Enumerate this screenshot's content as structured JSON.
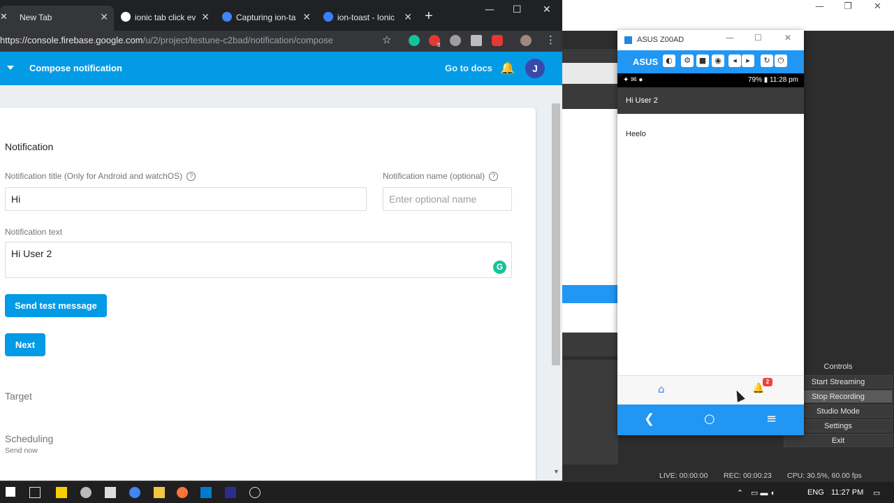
{
  "chrome": {
    "tabs": [
      {
        "label": "New Tab",
        "active": true
      },
      {
        "label": "ionic tab click ev",
        "active": false
      },
      {
        "label": "Capturing ion-ta",
        "active": false
      },
      {
        "label": "ion-toast - Ionic",
        "active": false
      }
    ],
    "url_host": "https://console.firebase.google.com",
    "url_path": "/u/2/project/testune-c2bad/notification/compose",
    "extension_badge": "8"
  },
  "firebase": {
    "page_title": "Compose notification",
    "go_to_docs": "Go to docs",
    "avatar_initial": "J",
    "section_title": "Notification",
    "title_label": "Notification title (Only for Android and watchOS)",
    "title_value": "Hi",
    "name_label": "Notification name (optional)",
    "name_placeholder": "Enter optional name",
    "text_label": "Notification text",
    "text_value": "Hi User 2",
    "send_test_button": "Send test message",
    "next_button": "Next",
    "target_section": "Target",
    "scheduling_section": "Scheduling",
    "scheduling_sub": "Send now"
  },
  "phone": {
    "window_title": "ASUS Z00AD",
    "toolbar_name": "ASUS",
    "battery": "79%",
    "time": "11:28 pm",
    "app_title": "Hi User 2",
    "body_text": "Heelo",
    "badge_count": "2"
  },
  "obs": {
    "controls_title": "Controls",
    "buttons": [
      "Start Streaming",
      "Stop Recording",
      "Studio Mode",
      "Settings",
      "Exit"
    ],
    "live": "LIVE: 00:00:00",
    "rec": "REC: 00:00:23",
    "cpu": "CPU: 30.5%, 60.00 fps"
  },
  "taskbar": {
    "lang": "ENG",
    "clock": "11:27 PM"
  },
  "colors": {
    "firebase_blue": "#039be5",
    "phone_blue": "#2196f3",
    "chrome_dark": "#202124"
  }
}
